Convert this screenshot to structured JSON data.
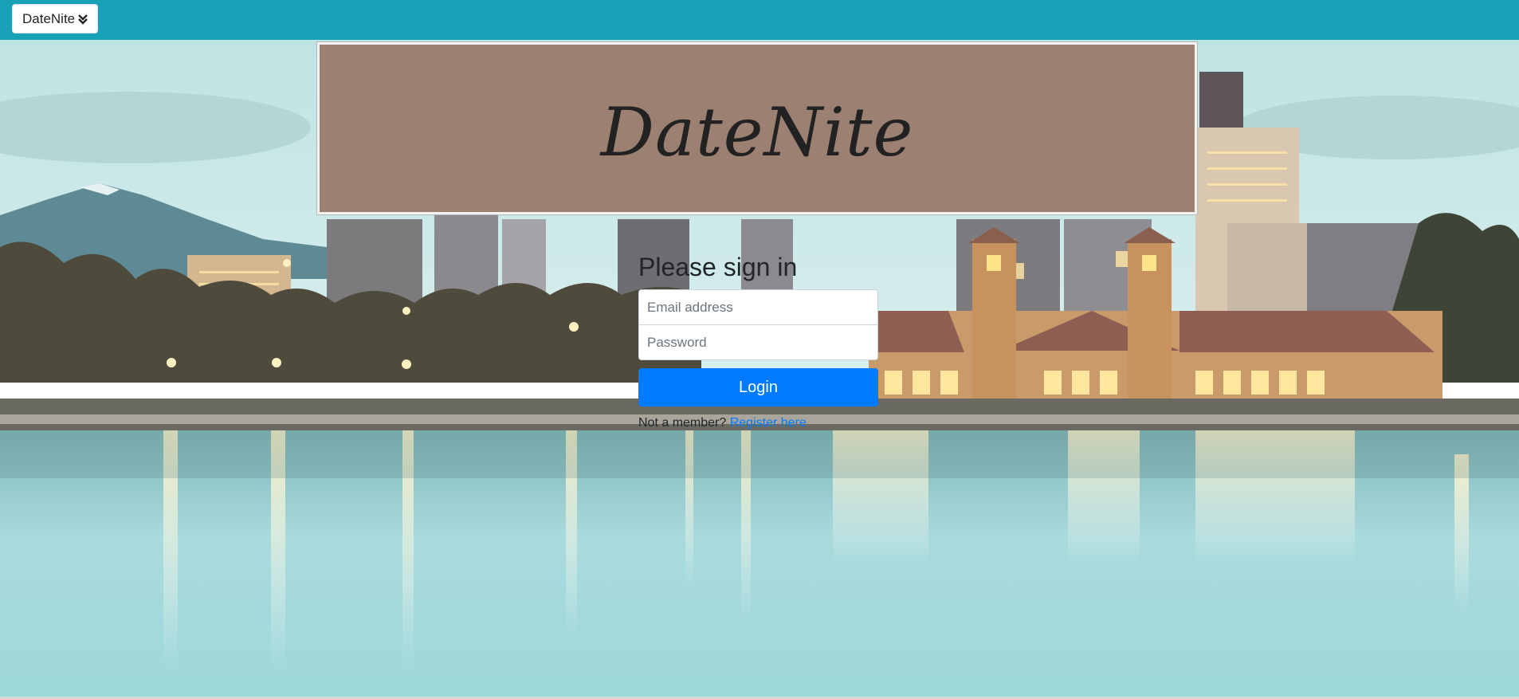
{
  "navbar": {
    "brand_button": "DateNite",
    "brand_icon": "double-chevron-down-icon",
    "background": "#17a2b8"
  },
  "banner": {
    "title": "DateNite",
    "background": "#9c8072"
  },
  "signin": {
    "heading": "Please sign in",
    "email_placeholder": "Email address",
    "password_placeholder": "Password",
    "login_label": "Login",
    "not_member_text": "Not a member?",
    "register_link": "Register here",
    "accent": "#007bff"
  }
}
